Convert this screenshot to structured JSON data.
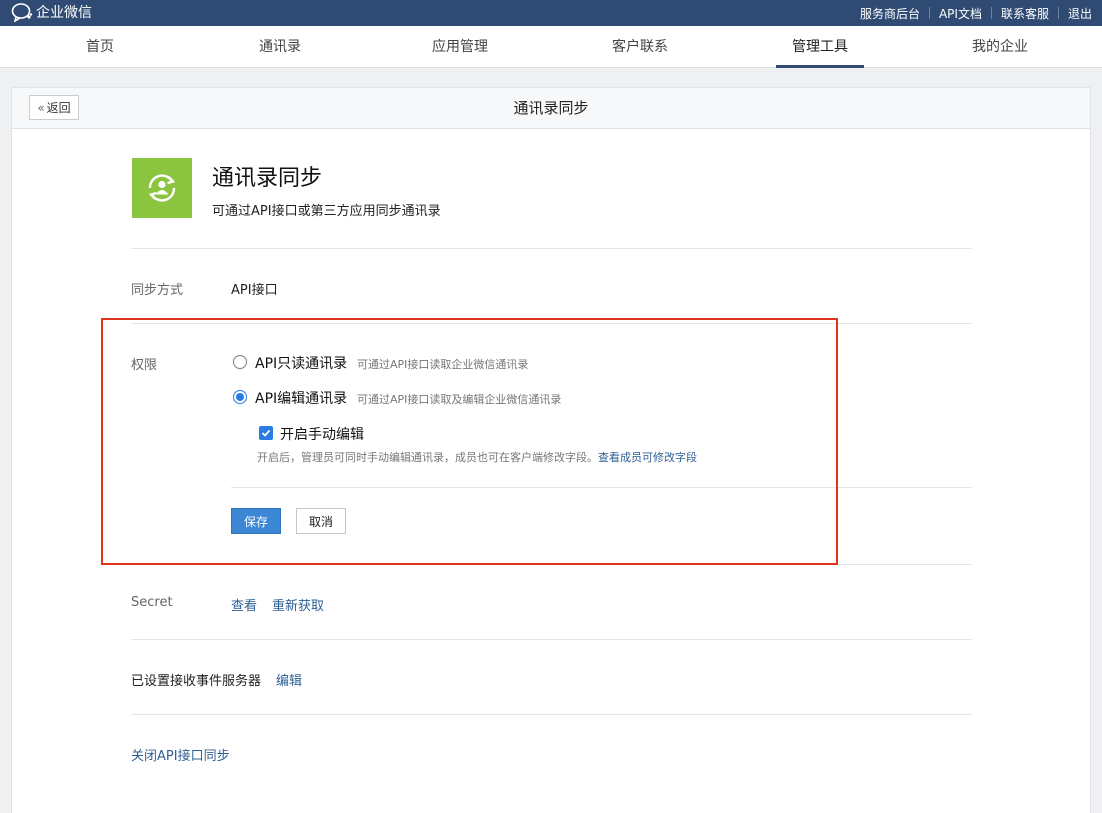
{
  "topbar": {
    "brand": "企业微信",
    "links": [
      "服务商后台",
      "API文档",
      "联系客服",
      "退出"
    ]
  },
  "nav": {
    "items": [
      "首页",
      "通讯录",
      "应用管理",
      "客户联系",
      "管理工具",
      "我的企业"
    ],
    "active": "管理工具"
  },
  "panel": {
    "back_label": "返回",
    "title": "通讯录同步"
  },
  "app": {
    "name": "通讯录同步",
    "desc": "可通过API接口或第三方应用同步通讯录",
    "icon": "sync-contacts-icon",
    "icon_color": "#8bc53f"
  },
  "sync_mode": {
    "label": "同步方式",
    "value": "API接口"
  },
  "permission": {
    "label": "权限",
    "options": [
      {
        "label": "API只读通讯录",
        "hint": "可通过API接口读取企业微信通讯录",
        "checked": false
      },
      {
        "label": "API编辑通讯录",
        "hint": "可通过API接口读取及编辑企业微信通讯录",
        "checked": true
      }
    ],
    "manual_edit": {
      "label": "开启手动编辑",
      "checked": true,
      "note": "开启后，管理员可同时手动编辑通讯录，成员也可在客户端修改字段。",
      "note_link": "查看成员可修改字段"
    },
    "save_label": "保存",
    "cancel_label": "取消"
  },
  "secret": {
    "label": "Secret",
    "view": "查看",
    "refresh": "重新获取"
  },
  "event_server": {
    "label": "已设置接收事件服务器",
    "edit": "编辑"
  },
  "close_link": "关闭API接口同步",
  "colors": {
    "topbar": "#2f4b73",
    "primary": "#3b87d4",
    "link": "#2e5f94",
    "highlight_box": "#e0341c"
  }
}
